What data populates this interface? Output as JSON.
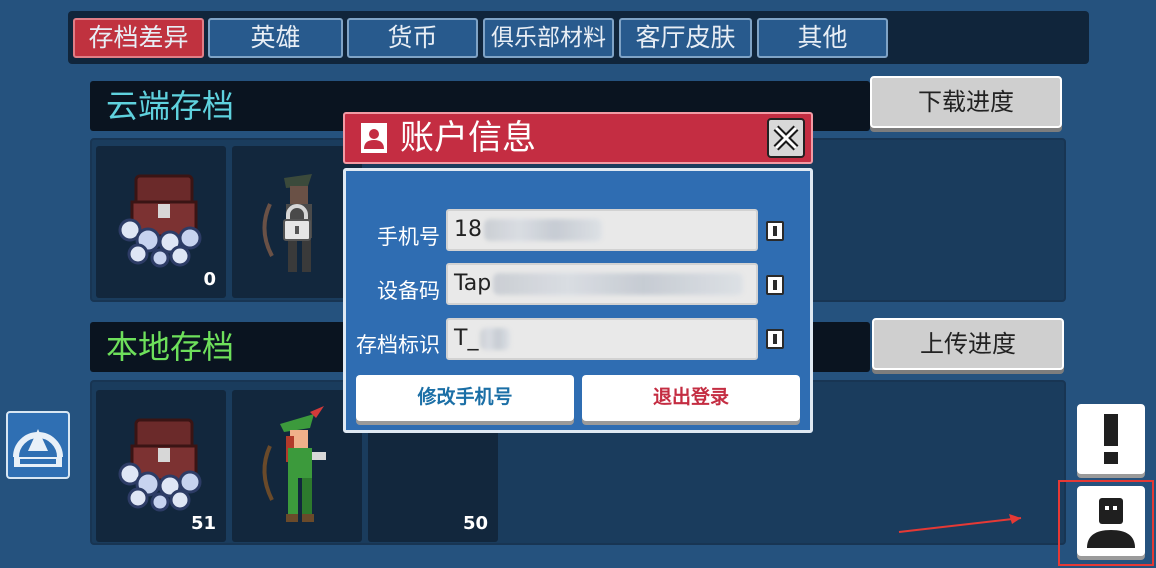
{
  "tabs": [
    {
      "label": "存档差异",
      "active": true
    },
    {
      "label": "英雄",
      "active": false
    },
    {
      "label": "货币",
      "active": false
    },
    {
      "label": "俱乐部材料",
      "active": false
    },
    {
      "label": "客厅皮肤",
      "active": false
    },
    {
      "label": "其他",
      "active": false
    }
  ],
  "cloud": {
    "title": "云端存档",
    "button": "下载进度",
    "slots": [
      {
        "icon": "treasure-chest-icon",
        "count": "0"
      },
      {
        "icon": "archer-hero-icon",
        "locked": true,
        "count": ""
      }
    ]
  },
  "local": {
    "title": "本地存档",
    "button": "上传进度",
    "slots": [
      {
        "icon": "treasure-chest-icon",
        "count": "51"
      },
      {
        "icon": "archer-hero-icon",
        "count": ""
      },
      {
        "icon": "",
        "count": "50"
      }
    ]
  },
  "modal": {
    "title": "账户信息",
    "fields": [
      {
        "label": "手机号",
        "value": "18"
      },
      {
        "label": "设备码",
        "value": "Tap"
      },
      {
        "label": "存档标识",
        "value": "T_"
      }
    ],
    "change_phone_button": "修改手机号",
    "logout_button": "退出登录"
  },
  "colors": {
    "background": "#25527e",
    "active_tab": "#c0323f",
    "cloud_title": "#5fd2de",
    "local_title": "#6ee05b",
    "modal_header": "#c42d42",
    "change_phone_text": "#1b6fa6",
    "logout_text": "#c42d42",
    "highlight": "#e53935"
  }
}
